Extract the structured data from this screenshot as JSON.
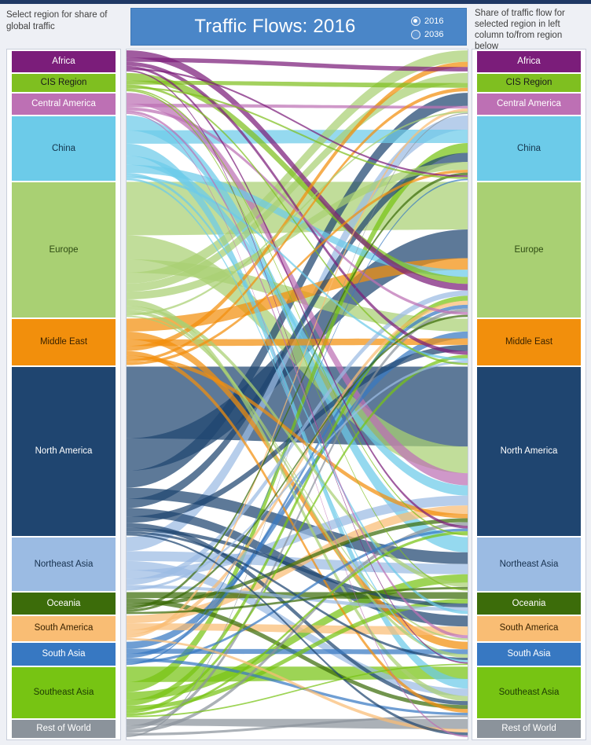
{
  "header": {
    "left_note": "Select region for share of global traffic",
    "title": "Traffic Flows: 2016",
    "right_note": "Share of traffic flow for selected region in left column to/from region below",
    "year_options": [
      {
        "label": "2016",
        "selected": true
      },
      {
        "label": "2036",
        "selected": false
      }
    ]
  },
  "colors": {
    "accent": "#4a86c8",
    "page_background": "#eef0f5",
    "panel_background": "#ffffff",
    "panel_border": "#c9cfdb",
    "top_strip": "#1f3864",
    "note_text": "#404040"
  },
  "regions": [
    {
      "key": "africa",
      "label": "Africa",
      "color": "#7b1d7a",
      "text_color": "#ffffff",
      "share": 3.0
    },
    {
      "key": "cis-region",
      "label": "CIS Region",
      "color": "#7fbf20",
      "text_color": "#1a1a1a",
      "share": 2.6
    },
    {
      "key": "central-america",
      "label": "Central America",
      "color": "#bd70b4",
      "text_color": "#ffffff",
      "share": 3.0
    },
    {
      "key": "china",
      "label": "China",
      "color": "#6ccbe9",
      "text_color": "#14354d",
      "share": 9.2
    },
    {
      "key": "europe",
      "label": "Europe",
      "color": "#a9d073",
      "text_color": "#2d4a12",
      "share": 19.2
    },
    {
      "key": "middle-east",
      "label": "Middle East",
      "color": "#f28f0c",
      "text_color": "#3a2300",
      "share": 6.6
    },
    {
      "key": "north-america",
      "label": "North America",
      "color": "#1f4570",
      "text_color": "#ffffff",
      "share": 24.0
    },
    {
      "key": "northeast-asia",
      "label": "Northeast Asia",
      "color": "#9bbbe3",
      "text_color": "#17314f",
      "share": 7.6
    },
    {
      "key": "oceania",
      "label": "Oceania",
      "color": "#3c6c0a",
      "text_color": "#ffffff",
      "share": 3.1
    },
    {
      "key": "south-america",
      "label": "South America",
      "color": "#f9bd74",
      "text_color": "#3a2300",
      "share": 3.5
    },
    {
      "key": "south-asia",
      "label": "South Asia",
      "color": "#3778c2",
      "text_color": "#ffffff",
      "share": 3.3
    },
    {
      "key": "southeast-asia",
      "label": "Southeast Asia",
      "color": "#77c413",
      "text_color": "#1d3a03",
      "share": 7.2
    },
    {
      "key": "rest-of-world",
      "label": "Rest of World",
      "color": "#8b939b",
      "text_color": "#ffffff",
      "share": 2.6
    }
  ],
  "chart_data": {
    "type": "sankey",
    "title": "Traffic Flows: 2016",
    "year": "2016",
    "left_axis_label": "Select region for share of global traffic",
    "right_axis_label": "Share of traffic flow for selected region in left column to/from region below",
    "nodes": [
      "Africa",
      "CIS Region",
      "Central America",
      "China",
      "Europe",
      "Middle East",
      "North America",
      "Northeast Asia",
      "Oceania",
      "South America",
      "South Asia",
      "Southeast Asia",
      "Rest of World"
    ],
    "node_shares_percent": {
      "Africa": 3.0,
      "CIS Region": 2.6,
      "Central America": 3.0,
      "China": 9.2,
      "Europe": 19.2,
      "Middle East": 6.6,
      "North America": 24.0,
      "Northeast Asia": 7.6,
      "Oceania": 3.1,
      "South America": 3.5,
      "South Asia": 3.3,
      "Southeast Asia": 7.2,
      "Rest of World": 2.6
    },
    "links": [
      {
        "source": "Africa",
        "target": "Europe",
        "value": 1.05
      },
      {
        "source": "Africa",
        "target": "Middle East",
        "value": 0.55
      },
      {
        "source": "Africa",
        "target": "Africa",
        "value": 0.6
      },
      {
        "source": "Africa",
        "target": "North America",
        "value": 0.35
      },
      {
        "source": "Africa",
        "target": "China",
        "value": 0.25
      },
      {
        "source": "Africa",
        "target": "South Asia",
        "value": 0.2
      },
      {
        "source": "CIS Region",
        "target": "Europe",
        "value": 1.1
      },
      {
        "source": "CIS Region",
        "target": "CIS Region",
        "value": 0.55
      },
      {
        "source": "CIS Region",
        "target": "Middle East",
        "value": 0.3
      },
      {
        "source": "CIS Region",
        "target": "China",
        "value": 0.25
      },
      {
        "source": "CIS Region",
        "target": "North America",
        "value": 0.2
      },
      {
        "source": "CIS Region",
        "target": "Northeast Asia",
        "value": 0.2
      },
      {
        "source": "Central America",
        "target": "North America",
        "value": 1.55
      },
      {
        "source": "Central America",
        "target": "Central America",
        "value": 0.5
      },
      {
        "source": "Central America",
        "target": "Europe",
        "value": 0.45
      },
      {
        "source": "Central America",
        "target": "South America",
        "value": 0.35
      },
      {
        "source": "Central America",
        "target": "Rest of World",
        "value": 0.15
      },
      {
        "source": "China",
        "target": "Northeast Asia",
        "value": 2.1
      },
      {
        "source": "China",
        "target": "China",
        "value": 1.9
      },
      {
        "source": "China",
        "target": "Southeast Asia",
        "value": 1.7
      },
      {
        "source": "China",
        "target": "North America",
        "value": 1.3
      },
      {
        "source": "China",
        "target": "Europe",
        "value": 1.15
      },
      {
        "source": "China",
        "target": "Oceania",
        "value": 0.4
      },
      {
        "source": "China",
        "target": "Middle East",
        "value": 0.35
      },
      {
        "source": "China",
        "target": "South Asia",
        "value": 0.3
      },
      {
        "source": "Europe",
        "target": "Europe",
        "value": 7.6
      },
      {
        "source": "Europe",
        "target": "North America",
        "value": 3.4
      },
      {
        "source": "Europe",
        "target": "Middle East",
        "value": 1.9
      },
      {
        "source": "Europe",
        "target": "Africa",
        "value": 1.55
      },
      {
        "source": "Europe",
        "target": "CIS Region",
        "value": 1.15
      },
      {
        "source": "Europe",
        "target": "China",
        "value": 1.1
      },
      {
        "source": "Europe",
        "target": "Southeast Asia",
        "value": 0.9
      },
      {
        "source": "Europe",
        "target": "Northeast Asia",
        "value": 0.6
      },
      {
        "source": "Europe",
        "target": "South Asia",
        "value": 0.5
      },
      {
        "source": "Europe",
        "target": "Central America",
        "value": 0.3
      },
      {
        "source": "Europe",
        "target": "South America",
        "value": 0.2
      },
      {
        "source": "Middle East",
        "target": "Europe",
        "value": 1.85
      },
      {
        "source": "Middle East",
        "target": "South Asia",
        "value": 1.1
      },
      {
        "source": "Middle East",
        "target": "Middle East",
        "value": 0.95
      },
      {
        "source": "Middle East",
        "target": "Africa",
        "value": 0.7
      },
      {
        "source": "Middle East",
        "target": "Southeast Asia",
        "value": 0.65
      },
      {
        "source": "Middle East",
        "target": "North America",
        "value": 0.55
      },
      {
        "source": "Middle East",
        "target": "CIS Region",
        "value": 0.4
      },
      {
        "source": "Middle East",
        "target": "China",
        "value": 0.4
      },
      {
        "source": "North America",
        "target": "North America",
        "value": 10.2
      },
      {
        "source": "North America",
        "target": "Europe",
        "value": 4.6
      },
      {
        "source": "North America",
        "target": "Central America",
        "value": 2.4
      },
      {
        "source": "North America",
        "target": "Northeast Asia",
        "value": 1.6
      },
      {
        "source": "North America",
        "target": "China",
        "value": 1.3
      },
      {
        "source": "North America",
        "target": "South America",
        "value": 1.2
      },
      {
        "source": "North America",
        "target": "Middle East",
        "value": 0.9
      },
      {
        "source": "North America",
        "target": "Southeast Asia",
        "value": 0.7
      },
      {
        "source": "North America",
        "target": "Oceania",
        "value": 0.5
      },
      {
        "source": "North America",
        "target": "South Asia",
        "value": 0.35
      },
      {
        "source": "North America",
        "target": "Rest of World",
        "value": 0.25
      },
      {
        "source": "Northeast Asia",
        "target": "China",
        "value": 2.0
      },
      {
        "source": "Northeast Asia",
        "target": "Northeast Asia",
        "value": 1.4
      },
      {
        "source": "Northeast Asia",
        "target": "Southeast Asia",
        "value": 1.3
      },
      {
        "source": "Northeast Asia",
        "target": "North America",
        "value": 1.25
      },
      {
        "source": "Northeast Asia",
        "target": "Europe",
        "value": 0.85
      },
      {
        "source": "Northeast Asia",
        "target": "Oceania",
        "value": 0.45
      },
      {
        "source": "Northeast Asia",
        "target": "Middle East",
        "value": 0.35
      },
      {
        "source": "Oceania",
        "target": "Oceania",
        "value": 0.85
      },
      {
        "source": "Oceania",
        "target": "Southeast Asia",
        "value": 0.7
      },
      {
        "source": "Oceania",
        "target": "North America",
        "value": 0.5
      },
      {
        "source": "Oceania",
        "target": "China",
        "value": 0.4
      },
      {
        "source": "Oceania",
        "target": "Europe",
        "value": 0.35
      },
      {
        "source": "Oceania",
        "target": "Northeast Asia",
        "value": 0.3
      },
      {
        "source": "South America",
        "target": "North America",
        "value": 1.1
      },
      {
        "source": "South America",
        "target": "South America",
        "value": 0.95
      },
      {
        "source": "South America",
        "target": "Europe",
        "value": 0.65
      },
      {
        "source": "South America",
        "target": "Central America",
        "value": 0.5
      },
      {
        "source": "South America",
        "target": "Rest of World",
        "value": 0.3
      },
      {
        "source": "South Asia",
        "target": "Middle East",
        "value": 1.0
      },
      {
        "source": "South Asia",
        "target": "South Asia",
        "value": 0.7
      },
      {
        "source": "South Asia",
        "target": "Europe",
        "value": 0.6
      },
      {
        "source": "South Asia",
        "target": "Southeast Asia",
        "value": 0.45
      },
      {
        "source": "South Asia",
        "target": "North America",
        "value": 0.35
      },
      {
        "source": "South Asia",
        "target": "China",
        "value": 0.2
      },
      {
        "source": "Southeast Asia",
        "target": "Southeast Asia",
        "value": 2.2
      },
      {
        "source": "Southeast Asia",
        "target": "China",
        "value": 1.4
      },
      {
        "source": "Southeast Asia",
        "target": "Northeast Asia",
        "value": 1.15
      },
      {
        "source": "Southeast Asia",
        "target": "Europe",
        "value": 0.8
      },
      {
        "source": "Southeast Asia",
        "target": "Oceania",
        "value": 0.6
      },
      {
        "source": "Southeast Asia",
        "target": "Middle East",
        "value": 0.5
      },
      {
        "source": "Southeast Asia",
        "target": "North America",
        "value": 0.35
      },
      {
        "source": "Southeast Asia",
        "target": "South Asia",
        "value": 0.2
      },
      {
        "source": "Rest of World",
        "target": "Rest of World",
        "value": 0.9
      },
      {
        "source": "Rest of World",
        "target": "Europe",
        "value": 0.55
      },
      {
        "source": "Rest of World",
        "target": "North America",
        "value": 0.45
      },
      {
        "source": "Rest of World",
        "target": "Southeast Asia",
        "value": 0.35
      },
      {
        "source": "Rest of World",
        "target": "Central America",
        "value": 0.2
      }
    ]
  }
}
